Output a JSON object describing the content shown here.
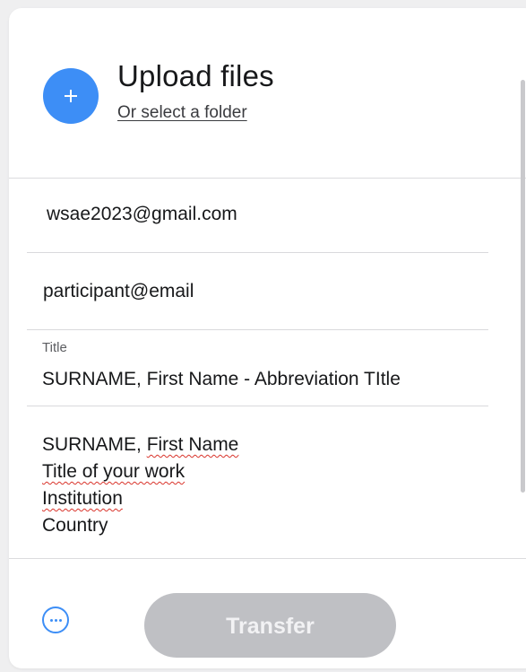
{
  "upload": {
    "title": "Upload files",
    "folder_link": "Or select a folder"
  },
  "fields": {
    "email_to": "wsae2023@gmail.com",
    "email_from": "participant@email",
    "title_label": "Title",
    "title_value": "SURNAME, First Name - Abbreviation TItle"
  },
  "message": {
    "line1_a": "SURNAME, ",
    "line1_b": "First Name",
    "line2": "Title of your work",
    "line3": "Institution",
    "line4": "Country"
  },
  "footer": {
    "transfer_label": "Transfer"
  },
  "icons": {
    "plus": "plus-icon",
    "more": "more-options-icon"
  },
  "colors": {
    "accent": "#3d8ef6",
    "disabled_button": "#bfc0c4",
    "spellcheck": "#d9342b"
  }
}
